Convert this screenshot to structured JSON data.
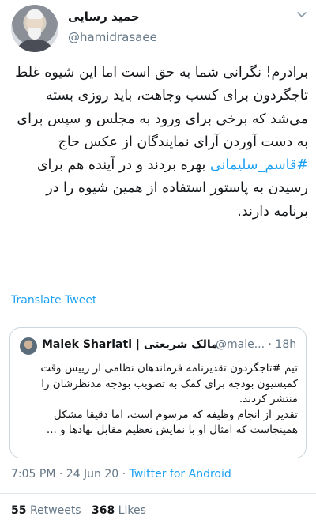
{
  "author": {
    "display_name": "حمید رسایی",
    "handle": "@hamidrasaee"
  },
  "tweet": {
    "text_part1": "برادرم! نگرانی شما به حق است اما این شیوه غلط تاجگردون برای کسب وجاهت، باید روزی بسته می‌شد که برخی برای ورود به مجلس و سپس برای به دست آوردن آرای نمایندگان از عکس حاج ",
    "hashtag": "#قاسم_سلیمانی",
    "text_part2": " بهره بردند و در آینده هم برای رسیدن به پاستور استفاده از همین شیوه را در برنامه دارند."
  },
  "translate_label": "Translate Tweet",
  "quoted_tweet": {
    "name": "Malek Shariati | مالک شریعتی",
    "handle": "@male...",
    "time": "· 18h",
    "text_line1": "تیم #تاجگردون تقدیرنامه فرماندهان نظامی از رییس وقت کمیسیون بودجه برای کمک به تصویب بودجه مدنظرشان را منتشر کردند.",
    "text_line2": "تقدیر از انجام وظیفه که مرسوم است، اما دقیقا مشکل همینجاست که امثال او با نمایش تعظیم مقابل نهادها و ..."
  },
  "meta": {
    "time": "7:05 PM",
    "date": "24 Jun 20",
    "source": "Twitter for Android"
  },
  "stats": {
    "retweets_count": "55",
    "retweets_label": "Retweets",
    "likes_count": "368",
    "likes_label": "Likes"
  },
  "icons": {
    "more": "chevron-down-icon"
  },
  "colors": {
    "link": "#1da1f2",
    "muted": "#657786",
    "text": "#14171a",
    "border": "#ccd6dd"
  }
}
